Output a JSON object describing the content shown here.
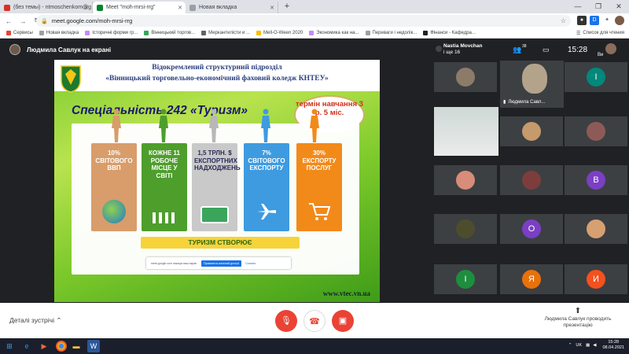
{
  "browser": {
    "tabs": [
      {
        "label": "(без темы) - ntmoschenkom@g",
        "icon_color": "#d93025",
        "active": false
      },
      {
        "label": "Meet \"moh-mrsi-rrg\"",
        "icon_color": "#00832d",
        "active": true
      },
      {
        "label": "Новая вкладка",
        "icon_color": "#9aa0a6",
        "active": false
      }
    ],
    "new_tab": "+",
    "window_controls": [
      "—",
      "❐",
      "✕"
    ],
    "url": "meet.google.com/moh-mrsi-rrg",
    "bookmarks": [
      "Сервисы",
      "Новая вкладка",
      "Історичні форми гр...",
      "Вінницький торгов...",
      "Меркантилісти и ...",
      "Mell-O-Ween 2020",
      "Экономика как на...",
      "Переваги і недолік...",
      "Фінанси - Кафедра..."
    ],
    "bookmarks_right": "Список для чтения"
  },
  "meet": {
    "presenter_label": "Людмила Савлук на екрані",
    "top_user_name": "Nastia Movchan",
    "top_user_sub": "і ще 16",
    "people_count": "38",
    "time": "15:28",
    "self_short": "Ви",
    "self_tile_name": "Людмила Савл...",
    "tiles": [
      {
        "letter": "",
        "color": "#8d7b6a"
      },
      {
        "letter": "І",
        "color": "#00897b"
      },
      {
        "letter": "",
        "color": "#5d7b8b"
      },
      {
        "letter": "",
        "color": "#c59a6c"
      },
      {
        "letter": "",
        "color": "#8e5a58"
      },
      {
        "letter": "",
        "color": "#d88c7a"
      },
      {
        "letter": "",
        "color": "#7d3d3d"
      },
      {
        "letter": "В",
        "color": "#7b3fc4"
      },
      {
        "letter": "",
        "color": "#4d4d2d"
      },
      {
        "letter": "О",
        "color": "#7b3fc4"
      },
      {
        "letter": "",
        "color": "#d7a071"
      },
      {
        "letter": "І",
        "color": "#1e8e3e"
      },
      {
        "letter": "Я",
        "color": "#e8710a"
      },
      {
        "letter": "И",
        "color": "#f4511e"
      }
    ],
    "details_label": "Деталі зустрічі",
    "present_text": "Людмила Савлук проводить презентацію"
  },
  "slide": {
    "header_line1": "Відокремлений структурний підрозділ",
    "header_line2": "«Вінницький торговельно-економічний фаховий коледж КНТЕУ»",
    "specialty": "Спеціальність 242 «Туризм»",
    "term": "термін навчання 3 р. 5 міс.",
    "cards": [
      {
        "text": "10% світового ВВП",
        "color": "#d89d6a",
        "icon": "globe-icon"
      },
      {
        "text": "кожне 11 робоче місце у світі",
        "color": "#4e9e2c",
        "icon": "people-icon"
      },
      {
        "text": "1,5 трлн. $ експортних надходжень",
        "color": "#c9c9c9",
        "icon": "money-icon"
      },
      {
        "text": "7% світового експорту",
        "color": "#3e9be0",
        "icon": "plane-icon"
      },
      {
        "text": "30% експорту послуг",
        "color": "#f28a1a",
        "icon": "cart-icon"
      }
    ],
    "banner": "ТУРИЗМ СТВОРЮЄ",
    "notice_text": "meet.google.com показує ваш екран",
    "notice_btn1": "Припинити спільний доступ",
    "notice_btn2": "Сховати",
    "site": "www.vtec.vn.ua"
  },
  "taskbar": {
    "lang": "UK",
    "time": "15:28",
    "date": "08.04.2021"
  }
}
